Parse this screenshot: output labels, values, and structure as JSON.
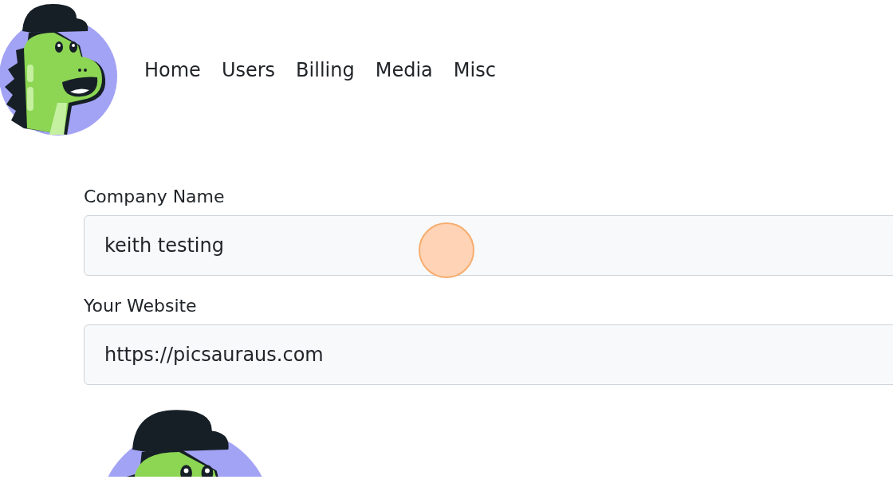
{
  "nav": {
    "items": [
      {
        "label": "Home"
      },
      {
        "label": "Users"
      },
      {
        "label": "Billing"
      },
      {
        "label": "Media"
      },
      {
        "label": "Misc"
      }
    ]
  },
  "form": {
    "fields": [
      {
        "label": "Company Name",
        "value": "keith testing"
      },
      {
        "label": "Your Website",
        "value": "https://picsauraus.com"
      }
    ]
  }
}
